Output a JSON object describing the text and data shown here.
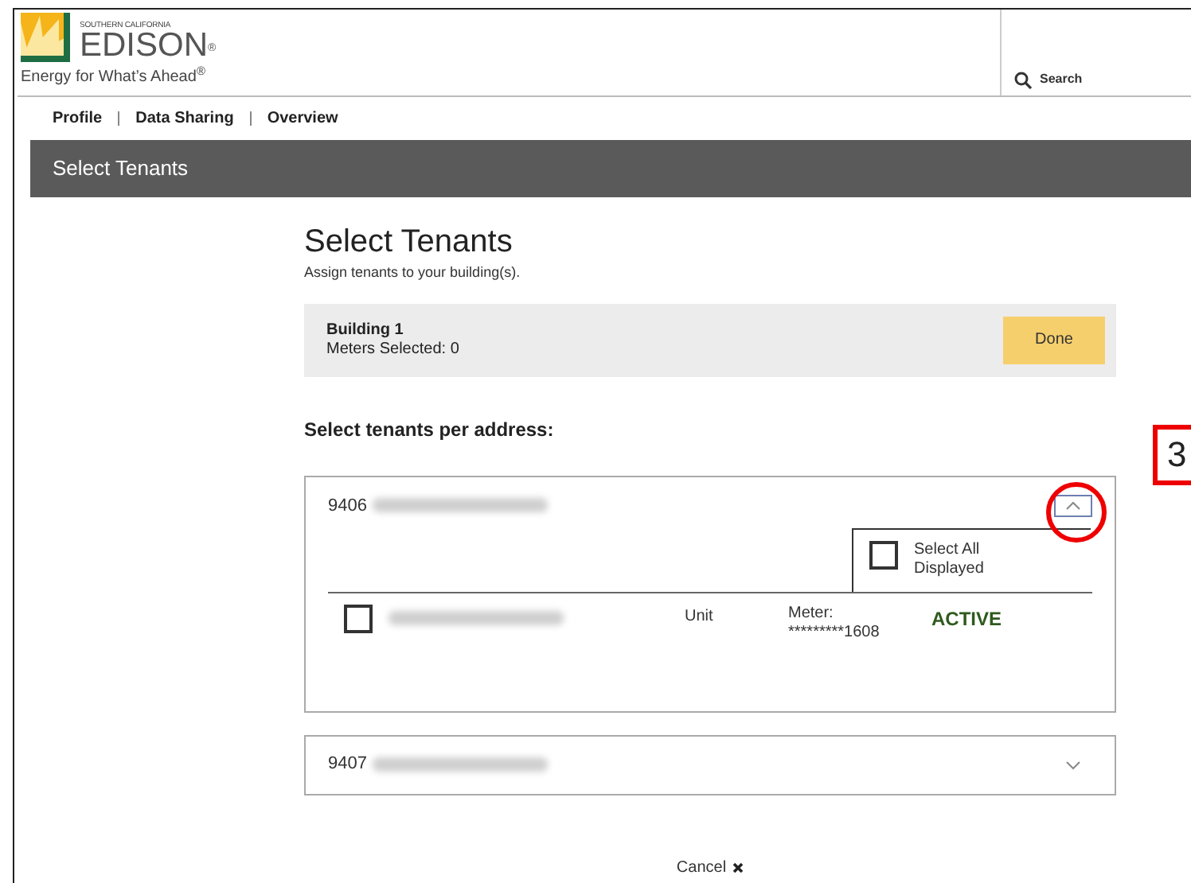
{
  "header": {
    "logo": {
      "overline": "SOUTHERN CALIFORNIA",
      "wordmark": "EDISON$^{®}$",
      "tagline": "Energy for What’s Ahead$^{®}$"
    },
    "search": {
      "label": "Search"
    }
  },
  "nav": [
    {
      "label": "Profile"
    },
    {
      "label": "Data Sharing"
    },
    {
      "label": "Overview"
    }
  ],
  "page_bar": {
    "title": "Select Tenants"
  },
  "heading": "Select Tenants",
  "subheading": "Assign tenants to your building(s).",
  "building": {
    "name": "Building 1",
    "meters_selected": "Meters Selected: 0",
    "done_button": "Done"
  },
  "section_label": "Select tenants per address:",
  "addresses": [
    {
      "number": "9406",
      "expanded": true,
      "select_all": {
        "label": "Select All Displayed",
        "checked": false
      },
      "tenants": [
        {
          "checked": false,
          "unit": "Unit",
          "meter_label": "Meter:",
          "meter_number": "*********1608",
          "status": "ACTIVE"
        }
      ]
    },
    {
      "number": "9407",
      "expanded": false
    }
  ],
  "cancel": "Cancel",
  "callout": {
    "label": "3"
  }
}
